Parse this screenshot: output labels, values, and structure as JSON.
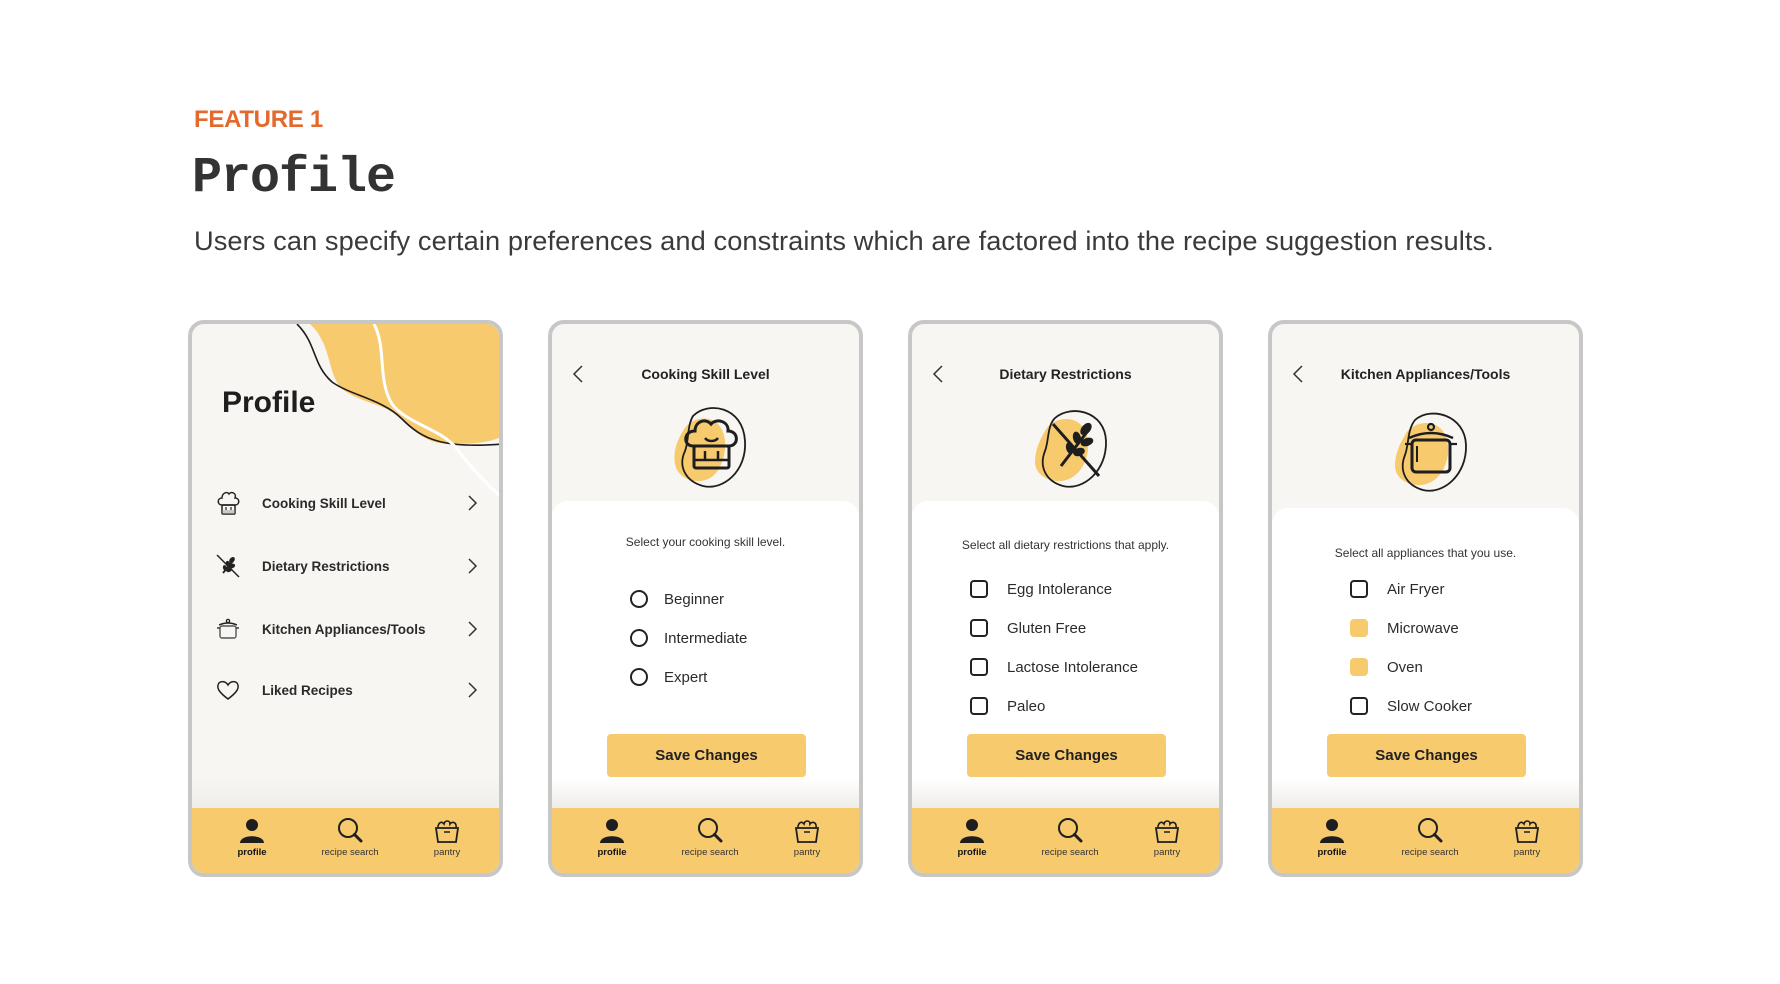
{
  "header": {
    "eyebrow": "FEATURE 1",
    "title": "Profile",
    "subtitle": "Users can specify certain preferences and constraints which are factored into the recipe suggestion results."
  },
  "colors": {
    "accent_orange": "#e4692c",
    "brand_yellow": "#f7ca6e",
    "screen_bg": "#f8f6f2",
    "frame": "#c7c7c7"
  },
  "nav": {
    "items": [
      {
        "label": "profile",
        "icon": "person-icon",
        "active": true
      },
      {
        "label": "recipe search",
        "icon": "search-icon",
        "active": false
      },
      {
        "label": "pantry",
        "icon": "basket-icon",
        "active": false
      }
    ]
  },
  "screens": {
    "profile": {
      "title": "Profile",
      "menu": [
        {
          "label": "Cooking Skill Level",
          "icon": "chef-hat-icon"
        },
        {
          "label": "Dietary Restrictions",
          "icon": "no-wheat-icon"
        },
        {
          "label": "Kitchen Appliances/Tools",
          "icon": "pot-icon"
        },
        {
          "label": "Liked Recipes",
          "icon": "heart-icon"
        }
      ]
    },
    "skill": {
      "title": "Cooking Skill Level",
      "icon": "chef-hat-icon",
      "instruction": "Select your cooking skill level.",
      "options": [
        {
          "label": "Beginner",
          "selected": false
        },
        {
          "label": "Intermediate",
          "selected": false
        },
        {
          "label": "Expert",
          "selected": false
        }
      ],
      "save_label": "Save Changes"
    },
    "dietary": {
      "title": "Dietary Restrictions",
      "icon": "no-wheat-icon",
      "instruction": "Select all dietary restrictions that apply.",
      "options": [
        {
          "label": "Egg Intolerance",
          "checked": false
        },
        {
          "label": "Gluten Free",
          "checked": false
        },
        {
          "label": "Lactose Intolerance",
          "checked": false
        },
        {
          "label": "Paleo",
          "checked": false
        }
      ],
      "save_label": "Save Changes"
    },
    "appliances": {
      "title": "Kitchen Appliances/Tools",
      "icon": "pot-icon",
      "instruction": "Select all appliances that you use.",
      "options": [
        {
          "label": "Air Fryer",
          "checked": false
        },
        {
          "label": "Microwave",
          "checked": true
        },
        {
          "label": "Oven",
          "checked": true
        },
        {
          "label": "Slow Cooker",
          "checked": false
        }
      ],
      "save_label": "Save Changes"
    }
  }
}
